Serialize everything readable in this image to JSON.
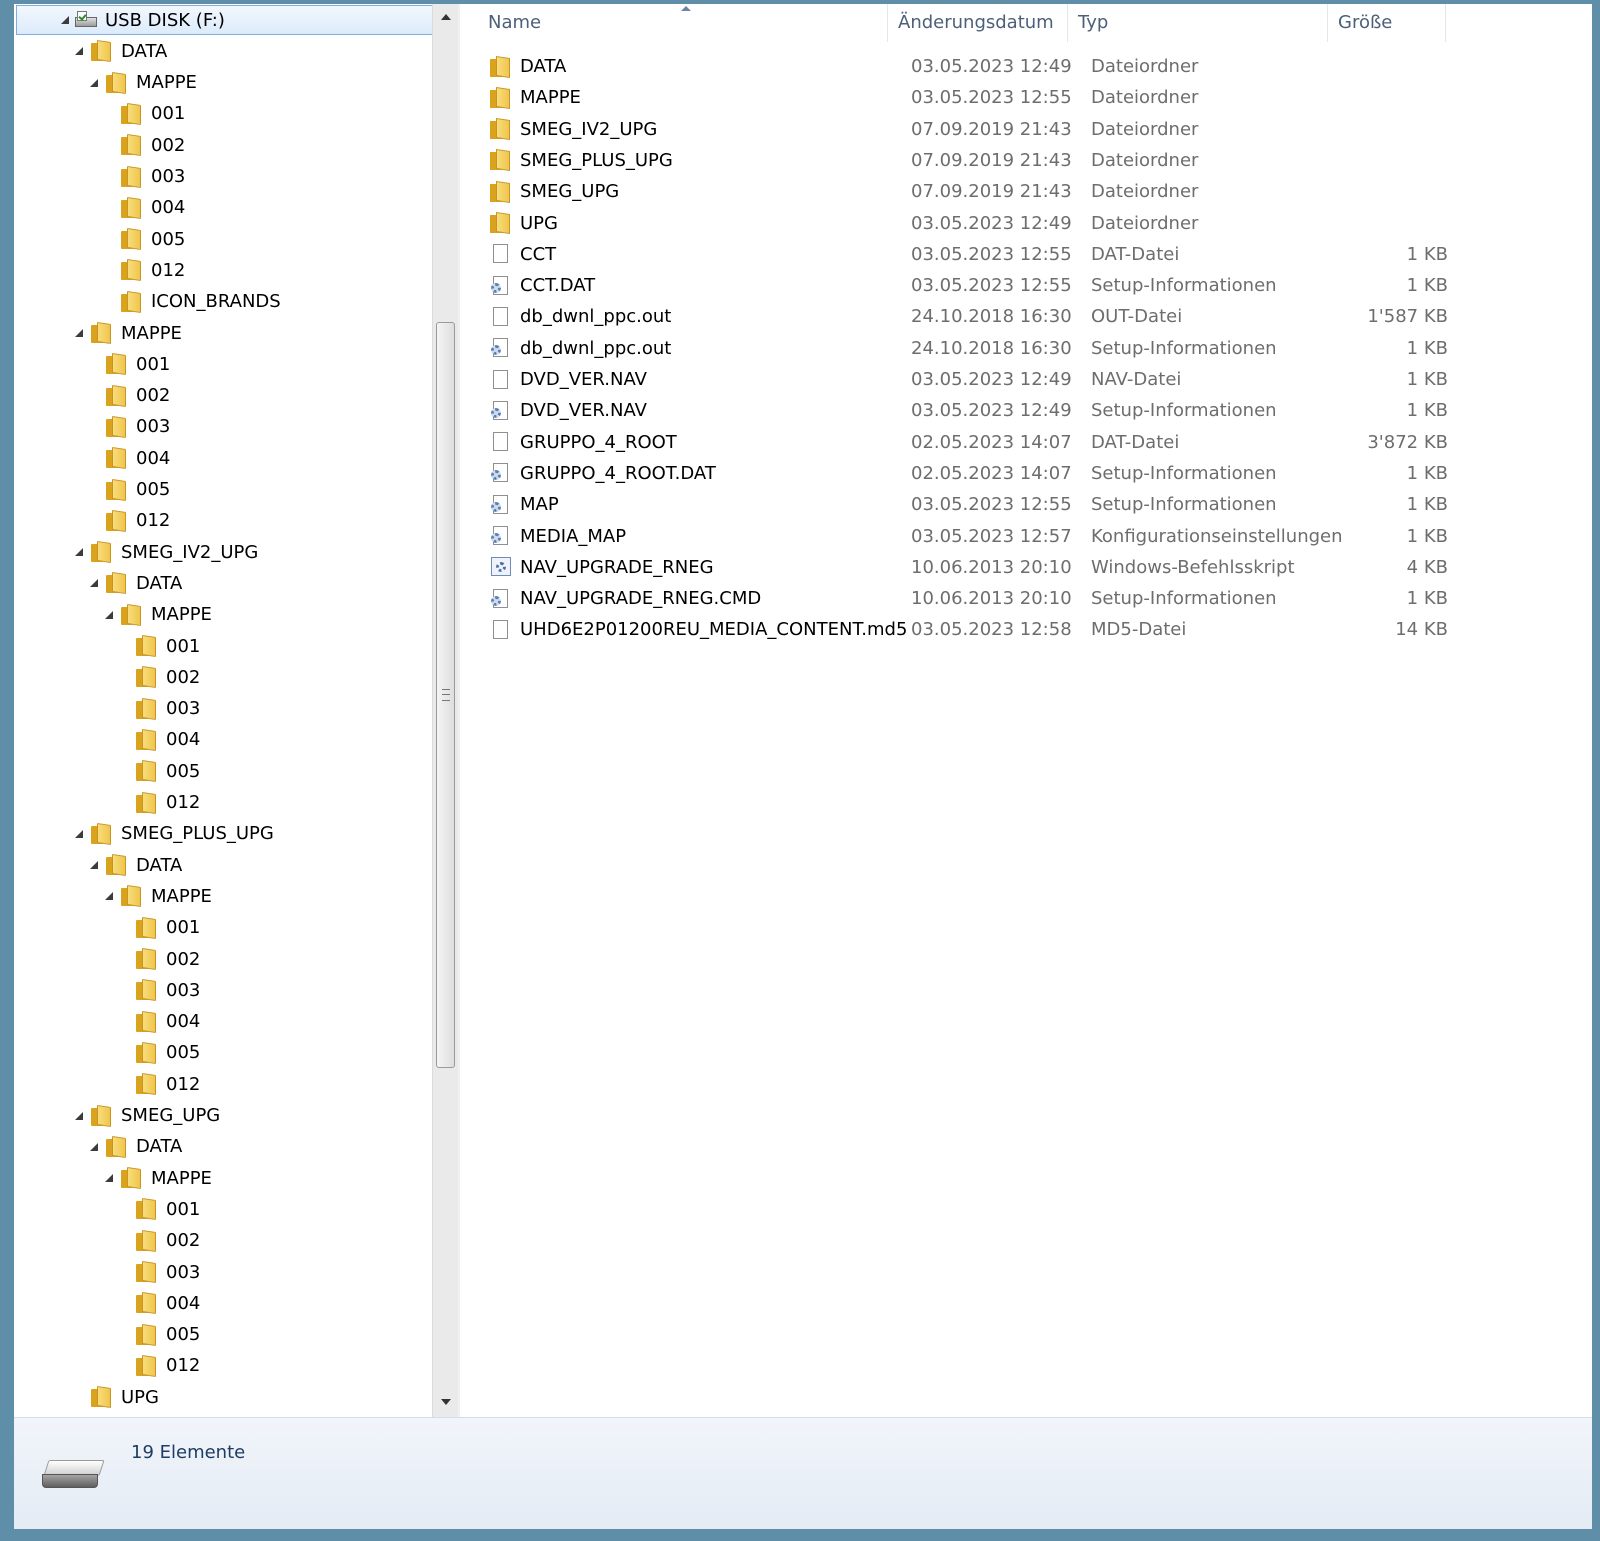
{
  "tree": {
    "items": [
      {
        "label": "USB DISK (F:)",
        "indent": 0,
        "expanded": true,
        "icon": "usb-drive-icon",
        "selected": true
      },
      {
        "label": "DATA",
        "indent": 1,
        "expanded": true,
        "icon": "folder-icon"
      },
      {
        "label": "MAPPE",
        "indent": 2,
        "expanded": true,
        "icon": "folder-icon"
      },
      {
        "label": "001",
        "indent": 3,
        "expanded": false,
        "icon": "folder-icon"
      },
      {
        "label": "002",
        "indent": 3,
        "expanded": false,
        "icon": "folder-icon"
      },
      {
        "label": "003",
        "indent": 3,
        "expanded": false,
        "icon": "folder-icon"
      },
      {
        "label": "004",
        "indent": 3,
        "expanded": false,
        "icon": "folder-icon"
      },
      {
        "label": "005",
        "indent": 3,
        "expanded": false,
        "icon": "folder-icon"
      },
      {
        "label": "012",
        "indent": 3,
        "expanded": false,
        "icon": "folder-icon"
      },
      {
        "label": "ICON_BRANDS",
        "indent": 3,
        "expanded": false,
        "icon": "folder-icon"
      },
      {
        "label": "MAPPE",
        "indent": 1,
        "expanded": true,
        "icon": "folder-icon"
      },
      {
        "label": "001",
        "indent": 2,
        "expanded": false,
        "icon": "folder-icon"
      },
      {
        "label": "002",
        "indent": 2,
        "expanded": false,
        "icon": "folder-icon"
      },
      {
        "label": "003",
        "indent": 2,
        "expanded": false,
        "icon": "folder-icon"
      },
      {
        "label": "004",
        "indent": 2,
        "expanded": false,
        "icon": "folder-icon"
      },
      {
        "label": "005",
        "indent": 2,
        "expanded": false,
        "icon": "folder-icon"
      },
      {
        "label": "012",
        "indent": 2,
        "expanded": false,
        "icon": "folder-icon"
      },
      {
        "label": "SMEG_IV2_UPG",
        "indent": 1,
        "expanded": true,
        "icon": "folder-icon"
      },
      {
        "label": "DATA",
        "indent": 2,
        "expanded": true,
        "icon": "folder-icon"
      },
      {
        "label": "MAPPE",
        "indent": 3,
        "expanded": true,
        "icon": "folder-icon"
      },
      {
        "label": "001",
        "indent": 4,
        "expanded": false,
        "icon": "folder-icon"
      },
      {
        "label": "002",
        "indent": 4,
        "expanded": false,
        "icon": "folder-icon"
      },
      {
        "label": "003",
        "indent": 4,
        "expanded": false,
        "icon": "folder-icon"
      },
      {
        "label": "004",
        "indent": 4,
        "expanded": false,
        "icon": "folder-icon"
      },
      {
        "label": "005",
        "indent": 4,
        "expanded": false,
        "icon": "folder-icon"
      },
      {
        "label": "012",
        "indent": 4,
        "expanded": false,
        "icon": "folder-icon"
      },
      {
        "label": "SMEG_PLUS_UPG",
        "indent": 1,
        "expanded": true,
        "icon": "folder-icon"
      },
      {
        "label": "DATA",
        "indent": 2,
        "expanded": true,
        "icon": "folder-icon"
      },
      {
        "label": "MAPPE",
        "indent": 3,
        "expanded": true,
        "icon": "folder-icon"
      },
      {
        "label": "001",
        "indent": 4,
        "expanded": false,
        "icon": "folder-icon"
      },
      {
        "label": "002",
        "indent": 4,
        "expanded": false,
        "icon": "folder-icon"
      },
      {
        "label": "003",
        "indent": 4,
        "expanded": false,
        "icon": "folder-icon"
      },
      {
        "label": "004",
        "indent": 4,
        "expanded": false,
        "icon": "folder-icon"
      },
      {
        "label": "005",
        "indent": 4,
        "expanded": false,
        "icon": "folder-icon"
      },
      {
        "label": "012",
        "indent": 4,
        "expanded": false,
        "icon": "folder-icon"
      },
      {
        "label": "SMEG_UPG",
        "indent": 1,
        "expanded": true,
        "icon": "folder-icon"
      },
      {
        "label": "DATA",
        "indent": 2,
        "expanded": true,
        "icon": "folder-icon"
      },
      {
        "label": "MAPPE",
        "indent": 3,
        "expanded": true,
        "icon": "folder-icon"
      },
      {
        "label": "001",
        "indent": 4,
        "expanded": false,
        "icon": "folder-icon"
      },
      {
        "label": "002",
        "indent": 4,
        "expanded": false,
        "icon": "folder-icon"
      },
      {
        "label": "003",
        "indent": 4,
        "expanded": false,
        "icon": "folder-icon"
      },
      {
        "label": "004",
        "indent": 4,
        "expanded": false,
        "icon": "folder-icon"
      },
      {
        "label": "005",
        "indent": 4,
        "expanded": false,
        "icon": "folder-icon"
      },
      {
        "label": "012",
        "indent": 4,
        "expanded": false,
        "icon": "folder-icon"
      },
      {
        "label": "UPG",
        "indent": 1,
        "expanded": false,
        "icon": "folder-icon"
      }
    ]
  },
  "list": {
    "columns": {
      "name": "Name",
      "date": "Änderungsdatum",
      "type": "Typ",
      "size": "Größe"
    },
    "files": [
      {
        "name": "DATA",
        "date": "03.05.2023 12:49",
        "type": "Dateiordner",
        "size": "",
        "icon": "folder"
      },
      {
        "name": "MAPPE",
        "date": "03.05.2023 12:55",
        "type": "Dateiordner",
        "size": "",
        "icon": "folder"
      },
      {
        "name": "SMEG_IV2_UPG",
        "date": "07.09.2019 21:43",
        "type": "Dateiordner",
        "size": "",
        "icon": "folder"
      },
      {
        "name": "SMEG_PLUS_UPG",
        "date": "07.09.2019 21:43",
        "type": "Dateiordner",
        "size": "",
        "icon": "folder"
      },
      {
        "name": "SMEG_UPG",
        "date": "07.09.2019 21:43",
        "type": "Dateiordner",
        "size": "",
        "icon": "folder"
      },
      {
        "name": "UPG",
        "date": "03.05.2023 12:49",
        "type": "Dateiordner",
        "size": "",
        "icon": "folder"
      },
      {
        "name": "CCT",
        "date": "03.05.2023 12:55",
        "type": "DAT-Datei",
        "size": "1 KB",
        "icon": "doc"
      },
      {
        "name": "CCT.DAT",
        "date": "03.05.2023 12:55",
        "type": "Setup-Informationen",
        "size": "1 KB",
        "icon": "gear"
      },
      {
        "name": "db_dwnl_ppc.out",
        "date": "24.10.2018 16:30",
        "type": "OUT-Datei",
        "size": "1'587 KB",
        "icon": "doc"
      },
      {
        "name": "db_dwnl_ppc.out",
        "date": "24.10.2018 16:30",
        "type": "Setup-Informationen",
        "size": "1 KB",
        "icon": "gear"
      },
      {
        "name": "DVD_VER.NAV",
        "date": "03.05.2023 12:49",
        "type": "NAV-Datei",
        "size": "1 KB",
        "icon": "doc"
      },
      {
        "name": "DVD_VER.NAV",
        "date": "03.05.2023 12:49",
        "type": "Setup-Informationen",
        "size": "1 KB",
        "icon": "gear"
      },
      {
        "name": "GRUPPO_4_ROOT",
        "date": "02.05.2023 14:07",
        "type": "DAT-Datei",
        "size": "3'872 KB",
        "icon": "doc"
      },
      {
        "name": "GRUPPO_4_ROOT.DAT",
        "date": "02.05.2023 14:07",
        "type": "Setup-Informationen",
        "size": "1 KB",
        "icon": "gear"
      },
      {
        "name": "MAP",
        "date": "03.05.2023 12:55",
        "type": "Setup-Informationen",
        "size": "1 KB",
        "icon": "gear"
      },
      {
        "name": "MEDIA_MAP",
        "date": "03.05.2023 12:57",
        "type": "Konfigurationseinstellungen",
        "size": "1 KB",
        "icon": "gear"
      },
      {
        "name": "NAV_UPGRADE_RNEG",
        "date": "10.06.2013 20:10",
        "type": "Windows-Befehlsskript",
        "size": "4 KB",
        "icon": "script"
      },
      {
        "name": "NAV_UPGRADE_RNEG.CMD",
        "date": "10.06.2013 20:10",
        "type": "Setup-Informationen",
        "size": "1 KB",
        "icon": "gear"
      },
      {
        "name": "UHD6E2P01200REU_MEDIA_CONTENT.md5",
        "date": "03.05.2023 12:58",
        "type": "MD5-Datei",
        "size": "14 KB",
        "icon": "doc"
      }
    ]
  },
  "status": {
    "count": "19 Elemente",
    "icon": "usb-drive-icon"
  },
  "colors": {
    "header_text": "#4c607a",
    "meta_text": "#6d6d6d",
    "selection_border": "#84acdd",
    "folder": "#f0c64c"
  }
}
